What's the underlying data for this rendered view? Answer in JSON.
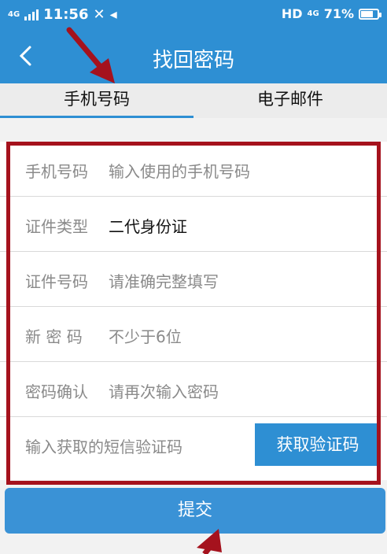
{
  "status_bar": {
    "network": "4G",
    "time": "11:56",
    "hd": "HD",
    "network2": "4G",
    "battery": "71%",
    "battery_level": 0.71
  },
  "header": {
    "title": "找回密码"
  },
  "tabs": [
    {
      "label": "手机号码",
      "active": true
    },
    {
      "label": "电子邮件",
      "active": false
    }
  ],
  "form": {
    "rows": [
      {
        "label": "手机号码",
        "value": "输入使用的手机号码",
        "is_placeholder": true
      },
      {
        "label": "证件类型",
        "value": "二代身份证",
        "is_placeholder": false
      },
      {
        "label": "证件号码",
        "value": "请准确完整填写",
        "is_placeholder": true
      },
      {
        "label": "新 密 码",
        "value": "不少于6位",
        "is_placeholder": true
      },
      {
        "label": "密码确认",
        "value": "请再次输入密码",
        "is_placeholder": true
      }
    ],
    "sms_placeholder": "输入获取的短信验证码",
    "sms_button": "获取验证码"
  },
  "submit_label": "提交",
  "colors": {
    "accent": "#2e8fd3",
    "highlight_border": "#a5121d",
    "annotation_arrow": "#a5121d"
  }
}
